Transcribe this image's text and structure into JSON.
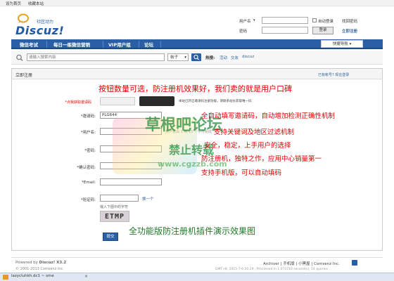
{
  "topbar": {
    "set_home": "设为首页",
    "bookmark": "收藏本站"
  },
  "logo": {
    "text": "Discuz!",
    "subtitle": "社区动力"
  },
  "login": {
    "username_label": "用户名",
    "password_label": "密码",
    "autologin_label": "自动登录",
    "forgot_password": "找回密码",
    "login_button": "登录",
    "register_link": "立即注册"
  },
  "nav": {
    "items": [
      "微信考试",
      "每日一练微信营销",
      "VIP用户组",
      "论坛"
    ],
    "quicknav": "快捷导航"
  },
  "search": {
    "placeholder": "请输入搜索内容",
    "type": "帖子",
    "hot_label": "热搜:",
    "hot_terms": [
      "活动",
      "交友",
      "discuz"
    ]
  },
  "page": {
    "title": "立即注册",
    "have_account": "已有帐号? 现在登录"
  },
  "form": {
    "phone_label": "*点我获取邀请码",
    "phone_note": "本站已开启邀请码注册功能，请联系站长获取唯一码",
    "invite_label": "*邀请码:",
    "invite_value": "PLG644",
    "username_label": "*用户名:",
    "username_hint": "用户名由 3 到 15 个字符组成",
    "password_label": "*密码:",
    "confirm_label": "*确认密码:",
    "email_label": "*Email:",
    "captcha_label": "*验证码:",
    "captcha_refresh": "换一个",
    "captcha_hint": "输入下图中的字符",
    "captcha_text": "ETMP",
    "submit": "提交"
  },
  "overlay": {
    "line1": "按钮数量可选，防注册机效果好，我们卖的就是用户口碑",
    "line2": "全自动填写邀请码，自动增加检测正确性机制",
    "line3": "支持关键词及地区过滤机制",
    "line4": "安全，稳定，上手用户的选择",
    "line5": "防注册机，独特之作，应用中心销量第一",
    "line6": "支持手机版，可以自动填码",
    "footer_caption": "全功能版防注册机插件演示效果图"
  },
  "watermark": {
    "title": "草根吧论坛",
    "ban": "禁止转载",
    "url": "www.cgzzb.com"
  },
  "footer": {
    "powered": "Powered by",
    "brand": "Discuz! X3.2",
    "copyright": "© 2001-2013 Comsenz Inc.",
    "links": [
      "Archiver",
      "手机版",
      "小黑屋",
      "Comsenz Inc."
    ],
    "gmt": "GMT+8, 2015-7-6 20:29 , Processed in 1.072710 second(s), 14 queries ."
  },
  "taskbar": {
    "tab": "lazycluhkh.dc1 ~ sme"
  },
  "colors": {
    "nav": "#2b5fa5",
    "link": "#336699",
    "overlay_text": "#e00000"
  }
}
